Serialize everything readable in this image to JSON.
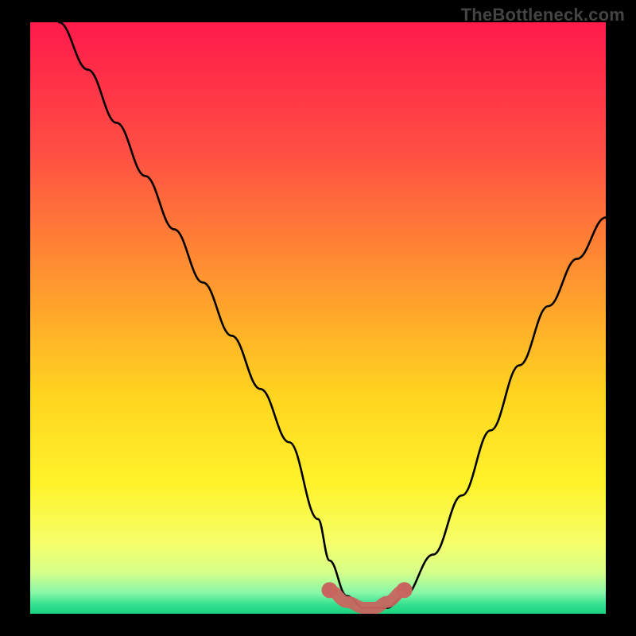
{
  "watermark": "TheBottleneck.com",
  "chart_data": {
    "type": "line",
    "title": "",
    "xlabel": "",
    "ylabel": "",
    "xlim": [
      0,
      100
    ],
    "ylim": [
      0,
      100
    ],
    "grid": false,
    "series": [
      {
        "name": "curve",
        "color": "#000000",
        "x": [
          5,
          10,
          15,
          20,
          25,
          30,
          35,
          40,
          45,
          50,
          52,
          55,
          58,
          60,
          62,
          65,
          70,
          75,
          80,
          85,
          90,
          95,
          100
        ],
        "y": [
          100,
          92,
          83,
          74,
          65,
          56,
          47,
          38,
          29,
          16,
          9,
          3,
          1,
          1,
          1,
          3,
          10,
          20,
          31,
          42,
          52,
          60,
          67
        ]
      }
    ],
    "highlight_segment": {
      "color": "#c8655f",
      "x": [
        52,
        55,
        58,
        60,
        62,
        65
      ],
      "y": [
        4,
        2,
        1,
        1,
        2,
        4
      ]
    },
    "background_gradient": {
      "stops": [
        {
          "offset": 0.0,
          "color": "#ff1a4b"
        },
        {
          "offset": 0.22,
          "color": "#ff4f43"
        },
        {
          "offset": 0.45,
          "color": "#ff9a2e"
        },
        {
          "offset": 0.63,
          "color": "#ffd41f"
        },
        {
          "offset": 0.78,
          "color": "#fff22a"
        },
        {
          "offset": 0.88,
          "color": "#f6ff6a"
        },
        {
          "offset": 0.93,
          "color": "#d6ff8a"
        },
        {
          "offset": 0.965,
          "color": "#86f7a8"
        },
        {
          "offset": 0.985,
          "color": "#33e08f"
        },
        {
          "offset": 1.0,
          "color": "#1bd37f"
        }
      ]
    }
  }
}
